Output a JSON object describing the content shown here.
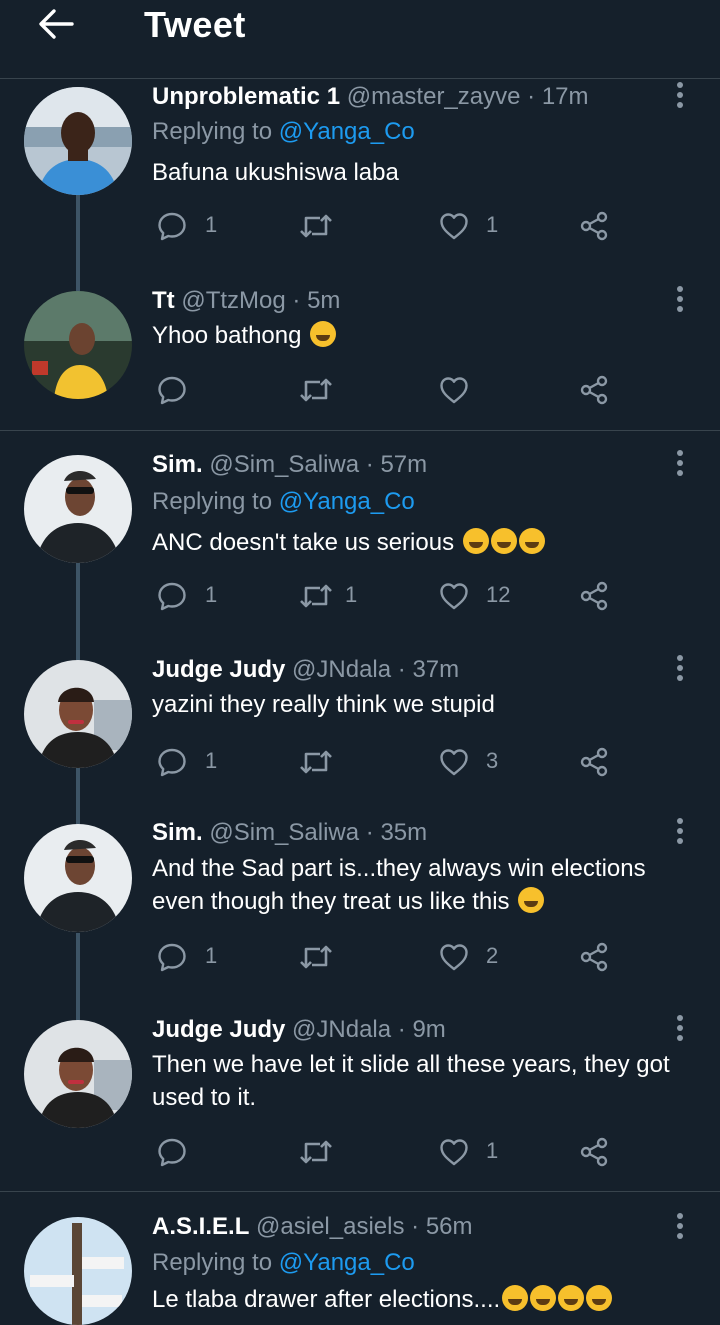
{
  "header": {
    "title": "Tweet",
    "back_icon": "arrow-left-icon"
  },
  "colors": {
    "background": "#15202b",
    "accent": "#1d9bf0",
    "muted": "#8b98a5",
    "divider": "#38444d"
  },
  "tweets": [
    {
      "name": "Unproblematic 1",
      "handle": "@master_zayve",
      "dot": "·",
      "time": "17m",
      "replying_prefix": "Replying to ",
      "replying_to": "@Yanga_Co",
      "text": "Bafuna ukushiswa laba",
      "replies": "1",
      "retweets": "",
      "likes": "1"
    },
    {
      "name": "Tt",
      "handle": "@TtzMog",
      "dot": "·",
      "time": "5m",
      "text": "Yhoo bathong",
      "replies": "",
      "retweets": "",
      "likes": ""
    },
    {
      "name": "Sim.",
      "handle": "@Sim_Saliwa",
      "dot": "·",
      "time": "57m",
      "replying_prefix": "Replying to ",
      "replying_to": "@Yanga_Co",
      "text": "ANC doesn't take us serious",
      "replies": "1",
      "retweets": "1",
      "likes": "12"
    },
    {
      "name": "Judge Judy",
      "handle": "@JNdala",
      "dot": "·",
      "time": "37m",
      "text": "yazini they really think we stupid",
      "replies": "1",
      "retweets": "",
      "likes": "3"
    },
    {
      "name": "Sim.",
      "handle": "@Sim_Saliwa",
      "dot": "·",
      "time": "35m",
      "text_line1": "And the Sad part is...they always win elections",
      "text_line2": "even though they treat us like this",
      "replies": "1",
      "retweets": "",
      "likes": "2"
    },
    {
      "name": "Judge Judy",
      "handle": "@JNdala",
      "dot": "·",
      "time": "9m",
      "text_line1": "Then we have let it slide all these years,  they got",
      "text_line2": "used to it.",
      "replies": "",
      "retweets": "",
      "likes": "1"
    },
    {
      "name": "A.S.I.E.L",
      "handle": "@asiel_asiels",
      "dot": "·",
      "time": "56m",
      "replying_prefix": "Replying to ",
      "replying_to": "@Yanga_Co",
      "text": "Le tlaba drawer after elections...."
    }
  ],
  "icons": {
    "reply": "reply-icon",
    "retweet": "retweet-icon",
    "like": "heart-icon",
    "share": "share-icon",
    "more": "more-vertical-icon"
  }
}
